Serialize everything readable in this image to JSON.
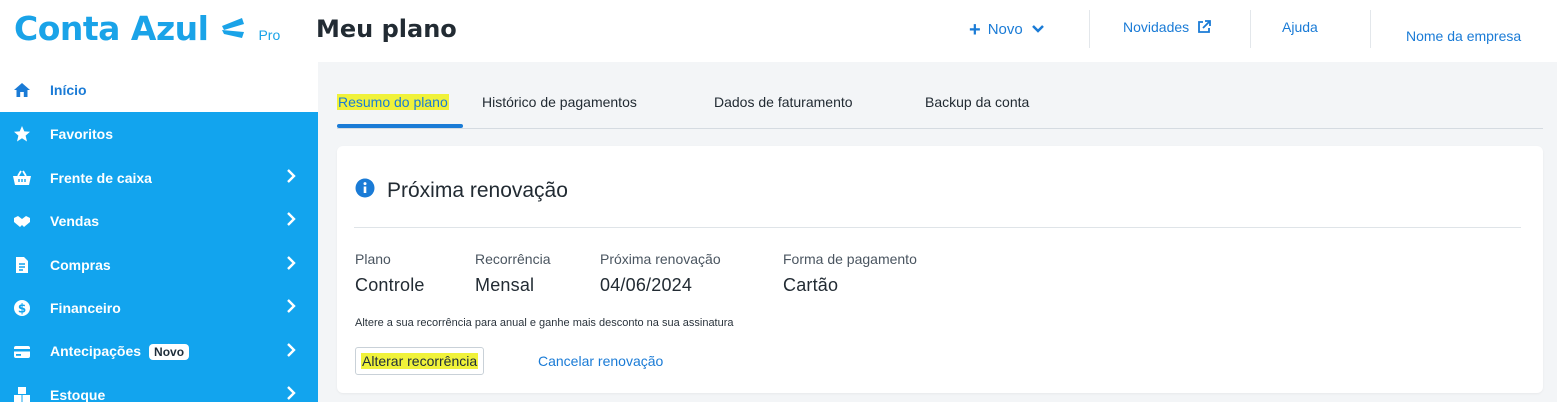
{
  "header": {
    "logo_text": "Conta Azul",
    "logo_badge": "Pro",
    "page_title": "Meu plano",
    "new_label": "Novo",
    "novidades_label": "Novidades",
    "ajuda_label": "Ajuda",
    "company_label": "Nome da empresa"
  },
  "sidebar": {
    "items": [
      {
        "label": "Início",
        "icon": "home-icon",
        "active": true
      },
      {
        "label": "Favoritos",
        "icon": "star-icon"
      },
      {
        "label": "Frente de caixa",
        "icon": "basket-icon",
        "chevron": true
      },
      {
        "label": "Vendas",
        "icon": "handshake-icon",
        "chevron": true
      },
      {
        "label": "Compras",
        "icon": "document-icon",
        "chevron": true
      },
      {
        "label": "Financeiro",
        "icon": "dollar-coin-icon",
        "chevron": true
      },
      {
        "label": "Antecipações",
        "icon": "card-icon",
        "chevron": true,
        "badge": "Novo"
      },
      {
        "label": "Estoque",
        "icon": "boxes-icon",
        "chevron": true
      }
    ]
  },
  "tabs": [
    {
      "label": "Resumo do plano",
      "active": true
    },
    {
      "label": "Histórico de pagamentos"
    },
    {
      "label": "Dados de faturamento"
    },
    {
      "label": "Backup da conta"
    }
  ],
  "renewal": {
    "title": "Próxima renovação",
    "fields": [
      {
        "label": "Plano",
        "value": "Controle"
      },
      {
        "label": "Recorrência",
        "value": "Mensal"
      },
      {
        "label": "Próxima renovação",
        "value": "04/06/2024"
      },
      {
        "label": "Forma de pagamento",
        "value": "Cartão"
      }
    ],
    "promo_text": "Altere a sua recorrência para anual e ganhe mais desconto na sua assinatura",
    "alter_button": "Alterar recorrência",
    "cancel_link": "Cancelar renovação"
  },
  "colors": {
    "brand": "#1aa3e8",
    "sidebar": "#12a4ee",
    "link": "#1a7bd6",
    "highlight": "#f0f23a"
  }
}
